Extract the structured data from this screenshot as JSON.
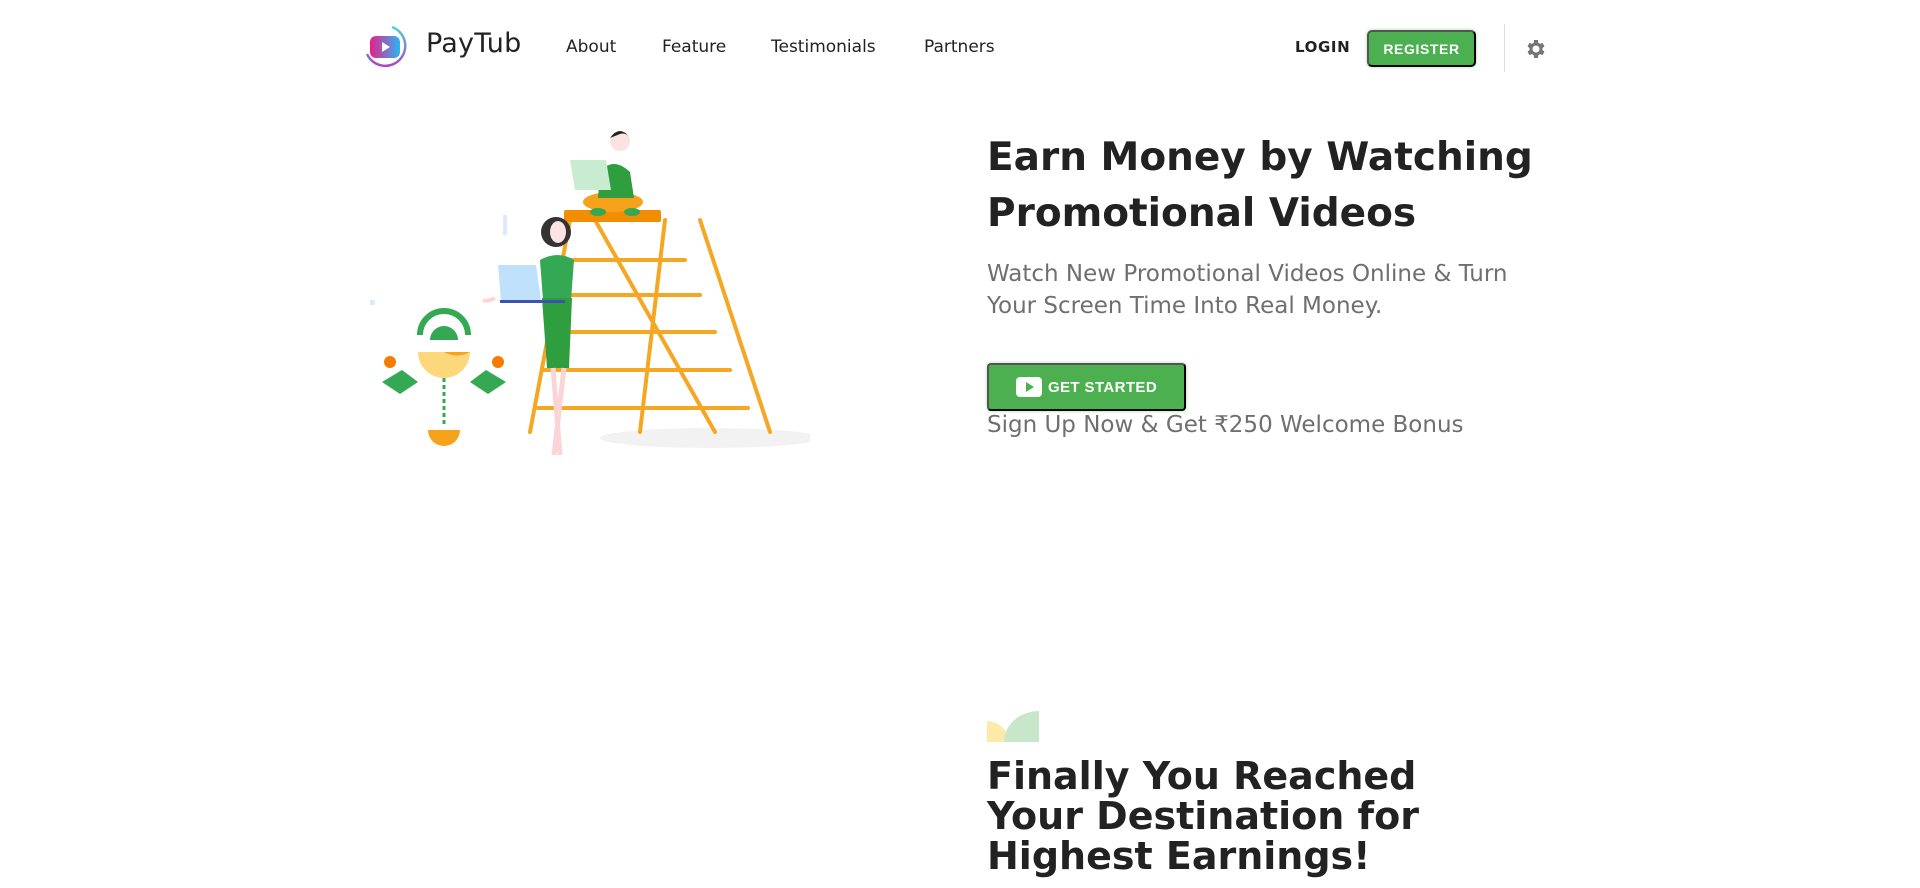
{
  "header": {
    "brand": "PayTub",
    "nav": [
      "About",
      "Feature",
      "Testimonials",
      "Partners"
    ],
    "login": "LOGIN",
    "register": "REGISTER",
    "settings_icon": "gear-icon"
  },
  "hero": {
    "title": "Earn Money by Watching Promotional Videos",
    "subtitle": "Watch New Promotional Videos Online & Turn Your Screen Time Into Real Money.",
    "cta": "GET STARTED",
    "cta_icon": "play-icon",
    "bonus": "Sign Up Now & Get ₹250 Welcome Bonus",
    "illustration": "people-with-laptops-ladder-illustration"
  },
  "section": {
    "title": "Finally You Reached Your Destination for Highest Earnings!"
  },
  "colors": {
    "accent": "#4caf50",
    "text_dark": "#222222",
    "text_muted": "#6f6f6f",
    "ladder": "#f5a623"
  }
}
